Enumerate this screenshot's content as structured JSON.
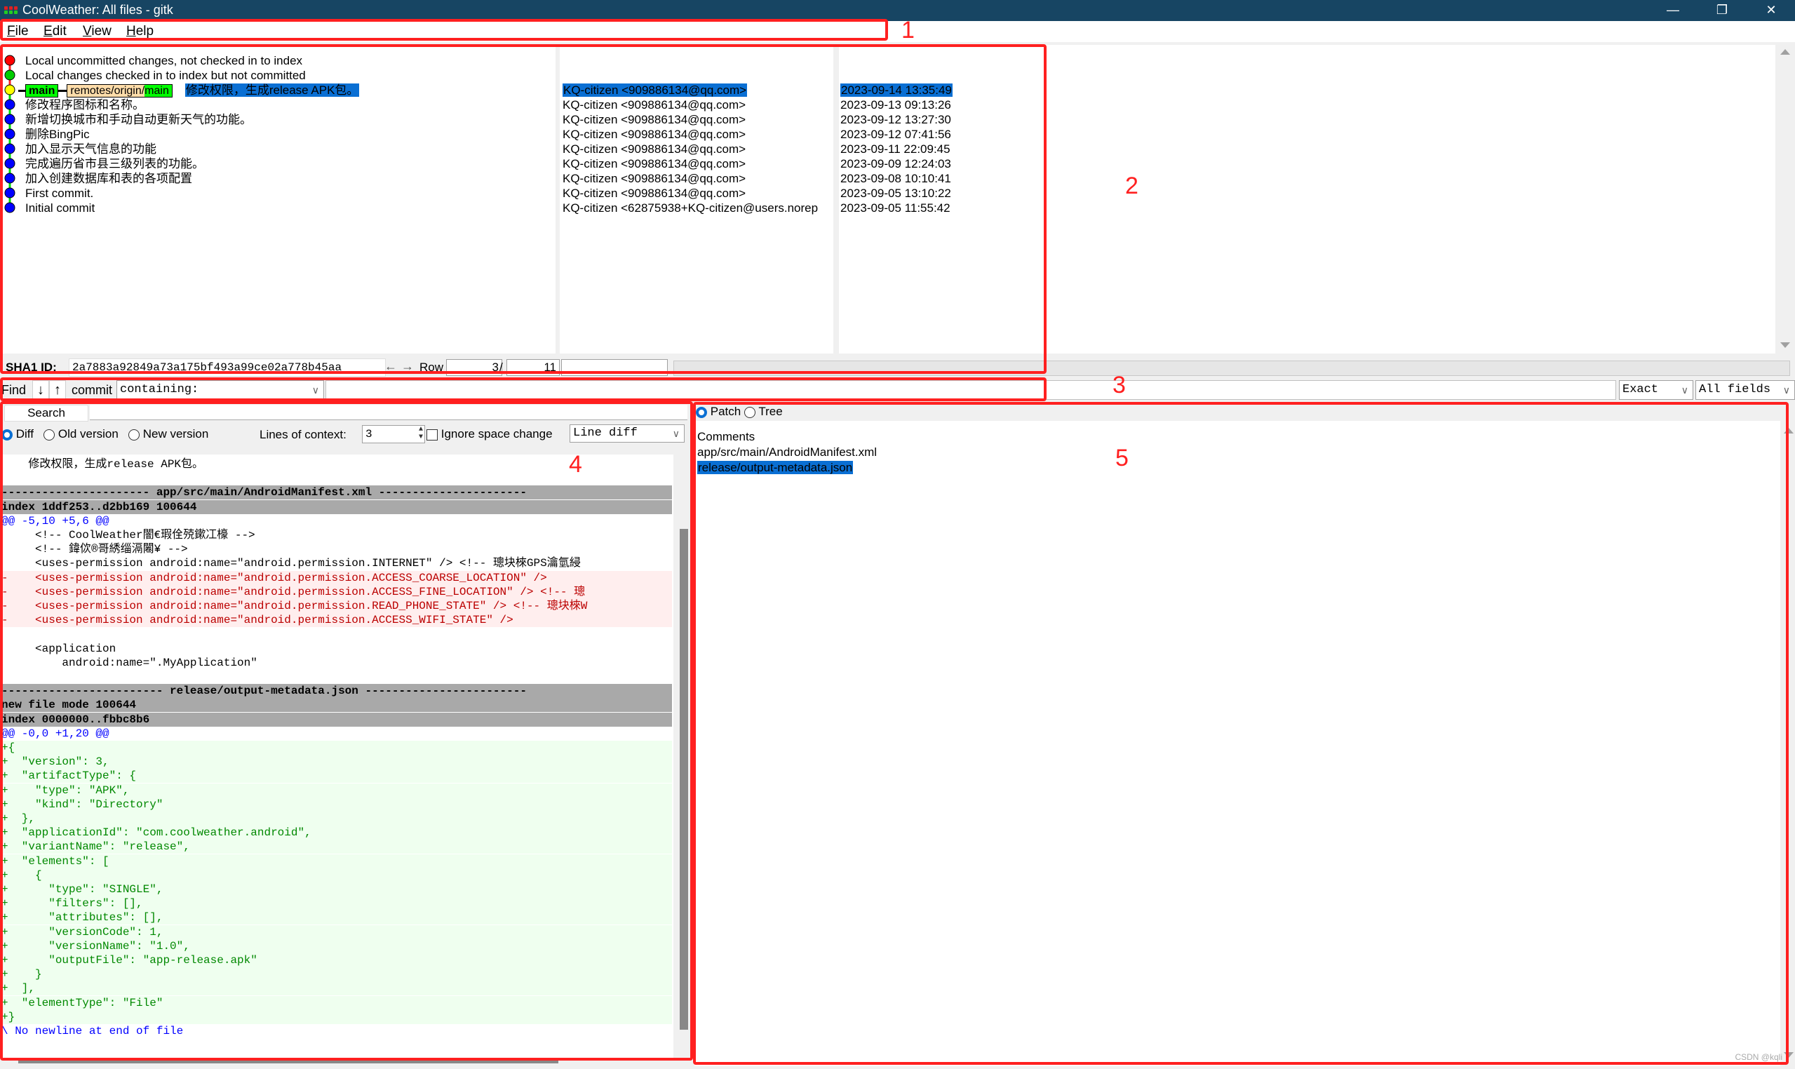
{
  "window": {
    "title": "CoolWeather: All files - gitk",
    "controls": {
      "minimize": "—",
      "restore": "❐",
      "close": "✕"
    }
  },
  "menu": [
    {
      "label": "File",
      "accel": "F",
      "rest": "ile"
    },
    {
      "label": "Edit",
      "accel": "E",
      "rest": "dit"
    },
    {
      "label": "View",
      "accel": "V",
      "rest": "iew"
    },
    {
      "label": "Help",
      "accel": "H",
      "rest": "elp"
    }
  ],
  "commits": [
    {
      "node_color": "#ff0000",
      "headline": "Local uncommitted changes, not checked in to index",
      "author": "",
      "date": ""
    },
    {
      "node_color": "#00cc00",
      "headline": "Local changes checked in to index but not committed",
      "author": "",
      "date": ""
    },
    {
      "node_color": "#ffff00",
      "headline": "修改权限，生成release APK包。",
      "author": "KQ-citizen <909886134@qq.com>",
      "date": "2023-09-14 13:35:49",
      "selected": true,
      "refs": [
        {
          "label": "main",
          "color": "#00ff00"
        },
        {
          "prefix": "remotes/origin/",
          "label": "main",
          "prefix_color": "#ffddaa",
          "color": "#00ff00"
        }
      ]
    },
    {
      "node_color": "#0000ff",
      "headline": "修改程序图标和名称。",
      "author": "KQ-citizen <909886134@qq.com>",
      "date": "2023-09-13 09:13:26"
    },
    {
      "node_color": "#0000ff",
      "headline": "新增切换城市和手动自动更新天气的功能。",
      "author": "KQ-citizen <909886134@qq.com>",
      "date": "2023-09-12 13:27:30"
    },
    {
      "node_color": "#0000ff",
      "headline": "删除BingPic",
      "author": "KQ-citizen <909886134@qq.com>",
      "date": "2023-09-12 07:41:56"
    },
    {
      "node_color": "#0000ff",
      "headline": "加入显示天气信息的功能",
      "author": "KQ-citizen <909886134@qq.com>",
      "date": "2023-09-11 22:09:45"
    },
    {
      "node_color": "#0000ff",
      "headline": "完成遍历省市县三级列表的功能。",
      "author": "KQ-citizen <909886134@qq.com>",
      "date": "2023-09-09 12:24:03"
    },
    {
      "node_color": "#0000ff",
      "headline": "加入创建数据库和表的各项配置",
      "author": "KQ-citizen <909886134@qq.com>",
      "date": "2023-09-08 10:10:41"
    },
    {
      "node_color": "#0000ff",
      "headline": "First commit.",
      "author": "KQ-citizen <909886134@qq.com>",
      "date": "2023-09-05 13:10:22"
    },
    {
      "node_color": "#0000ff",
      "headline": "Initial commit",
      "author": "KQ-citizen <62875938+KQ-citizen@users.norep",
      "date": "2023-09-05 11:55:42"
    }
  ],
  "sha_bar": {
    "label": "SHA1 ID:",
    "sha": "2a7883a92849a73a175bf493a99ce02a778b45aa",
    "back_icon": "←",
    "forward_icon": "→",
    "row_label": "Row",
    "row_current": "3",
    "row_sep": "/",
    "row_total": "11"
  },
  "find_bar": {
    "label": "Find",
    "down_icon": "↓",
    "up_icon": "↑",
    "type_label": "commit",
    "mode": "containing:",
    "query": "",
    "match": "Exact",
    "fields": "All fields"
  },
  "diff_controls": {
    "search_button": "Search",
    "search_value": "",
    "view_options": [
      {
        "label": "Diff",
        "checked": true
      },
      {
        "label": "Old version",
        "checked": false
      },
      {
        "label": "New version",
        "checked": false
      }
    ],
    "context_label": "Lines of context:",
    "context_value": "3",
    "ignore_space_label": "Ignore space change",
    "ignore_space_checked": false,
    "diff_mode": "Line diff"
  },
  "diff_lines": [
    {
      "type": "comment",
      "text": "    修改权限，生成release APK包。"
    },
    {
      "type": "blank",
      "text": ""
    },
    {
      "type": "hdr",
      "text": "---------------------- app/src/main/AndroidManifest.xml ----------------------"
    },
    {
      "type": "hdr",
      "text": "index 1ddf253..d2bb169 100644"
    },
    {
      "type": "hunk",
      "text": "@@ -5,10 +5,6 @@"
    },
    {
      "type": "ctx",
      "text": "     <!-- CoolWeather闇€瑕佺殑鏉冮檺 -->"
    },
    {
      "type": "ctx",
      "text": "     <!-- 鍏佽®哥綉缁滆闂¥ -->"
    },
    {
      "type": "ctx",
      "text": "     <uses-permission android:name=\"android.permission.INTERNET\" /> <!-- 璁块棶GPS瀹氫綅"
    },
    {
      "type": "del",
      "text": "-    <uses-permission android:name=\"android.permission.ACCESS_COARSE_LOCATION\" />"
    },
    {
      "type": "del",
      "text": "-    <uses-permission android:name=\"android.permission.ACCESS_FINE_LOCATION\" /> <!-- 璁"
    },
    {
      "type": "del",
      "text": "-    <uses-permission android:name=\"android.permission.READ_PHONE_STATE\" /> <!-- 璁块棶W"
    },
    {
      "type": "del",
      "text": "-    <uses-permission android:name=\"android.permission.ACCESS_WIFI_STATE\" />"
    },
    {
      "type": "ctx",
      "text": " "
    },
    {
      "type": "ctx",
      "text": "     <application"
    },
    {
      "type": "ctx",
      "text": "         android:name=\".MyApplication\""
    },
    {
      "type": "blank",
      "text": ""
    },
    {
      "type": "hdr",
      "text": "------------------------ release/output-metadata.json ------------------------"
    },
    {
      "type": "hdr",
      "text": "new file mode 100644"
    },
    {
      "type": "hdr",
      "text": "index 0000000..fbbc8b6"
    },
    {
      "type": "hunk",
      "text": "@@ -0,0 +1,20 @@"
    },
    {
      "type": "add",
      "text": "+{"
    },
    {
      "type": "add",
      "text": "+  \"version\": 3,"
    },
    {
      "type": "add",
      "text": "+  \"artifactType\": {"
    },
    {
      "type": "add",
      "text": "+    \"type\": \"APK\","
    },
    {
      "type": "add",
      "text": "+    \"kind\": \"Directory\""
    },
    {
      "type": "add",
      "text": "+  },"
    },
    {
      "type": "add",
      "text": "+  \"applicationId\": \"com.coolweather.android\","
    },
    {
      "type": "add",
      "text": "+  \"variantName\": \"release\","
    },
    {
      "type": "add",
      "text": "+  \"elements\": ["
    },
    {
      "type": "add",
      "text": "+    {"
    },
    {
      "type": "add",
      "text": "+      \"type\": \"SINGLE\","
    },
    {
      "type": "add",
      "text": "+      \"filters\": [],"
    },
    {
      "type": "add",
      "text": "+      \"attributes\": [],"
    },
    {
      "type": "add",
      "text": "+      \"versionCode\": 1,"
    },
    {
      "type": "add",
      "text": "+      \"versionName\": \"1.0\","
    },
    {
      "type": "add",
      "text": "+      \"outputFile\": \"app-release.apk\""
    },
    {
      "type": "add",
      "text": "+    }"
    },
    {
      "type": "add",
      "text": "+  ],"
    },
    {
      "type": "add",
      "text": "+  \"elementType\": \"File\""
    },
    {
      "type": "add",
      "text": "+}"
    },
    {
      "type": "nonl",
      "text": "\\ No newline at end of file"
    }
  ],
  "file_panel": {
    "view_options": [
      {
        "label": "Patch",
        "checked": true
      },
      {
        "label": "Tree",
        "checked": false
      }
    ],
    "files": [
      {
        "name": "Comments",
        "selected": false
      },
      {
        "name": "app/src/main/AndroidManifest.xml",
        "selected": false
      },
      {
        "name": "release/output-metadata.json",
        "selected": true
      }
    ]
  },
  "annotations": [
    "1",
    "2",
    "3",
    "4",
    "5"
  ],
  "watermark": "CSDN @kqli",
  "colors": {
    "titlebar": "#174563",
    "selection": "#0a6fd3",
    "annotation": "#ff2020",
    "diff_add": "#008800",
    "diff_del": "#bb0000",
    "diff_hunk": "#0000ff",
    "diff_header_bg": "#a9a9a9"
  }
}
